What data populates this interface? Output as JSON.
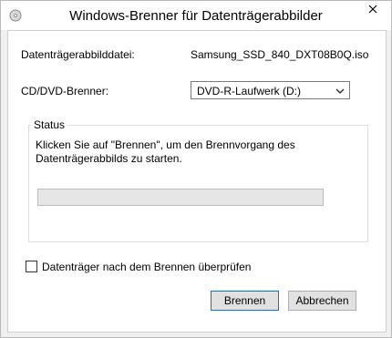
{
  "window": {
    "title": "Windows-Brenner für Datenträgerabbilder"
  },
  "form": {
    "image_file_label": "Datenträgerabbilddatei:",
    "image_file_value": "Samsung_SSD_840_DXT08B0Q.iso",
    "burner_label": "CD/DVD-Brenner:",
    "burner_selected": "DVD-R-Laufwerk (D:)"
  },
  "status": {
    "group_title": "Status",
    "message": "Klicken Sie auf \"Brennen\", um den Brennvorgang des Datenträgerabbilds zu starten.",
    "progress_fraction": 0
  },
  "verify": {
    "label": "Datenträger nach dem Brennen überprüfen",
    "checked": false
  },
  "buttons": {
    "burn": "Brennen",
    "cancel": "Abbrechen"
  },
  "icons": {
    "app": "disc-burner-icon",
    "close": "close-icon",
    "dropdown": "chevron-down-icon"
  }
}
